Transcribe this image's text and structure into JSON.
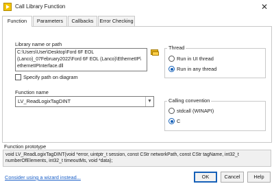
{
  "window": {
    "title": "Call Library Function",
    "close_glyph": "✕"
  },
  "tabs": [
    {
      "label": "Function",
      "active": true
    },
    {
      "label": "Parameters",
      "active": false
    },
    {
      "label": "Callbacks",
      "active": false
    },
    {
      "label": "Error Checking",
      "active": false
    }
  ],
  "library": {
    "label": "Library name or path",
    "path_lines": [
      "C:\\Users\\User\\Desktop\\Ford 6F EOL",
      "(Lanco)_07February2022\\Ford 6F EOL (Lanco)\\EthernetIP\\",
      "ethernetIPInterface.dll"
    ],
    "specify_path_label": "Specify path on diagram",
    "specify_path_checked": false
  },
  "thread": {
    "title": "Thread",
    "options": [
      {
        "label": "Run in UI thread",
        "selected": false
      },
      {
        "label": "Run in any thread",
        "selected": true
      }
    ]
  },
  "function": {
    "label": "Function name",
    "value": "LV_ReadLogixTagDINT"
  },
  "calling_convention": {
    "title": "Calling convention",
    "options": [
      {
        "label": "stdcall (WINAPI)",
        "selected": false
      },
      {
        "label": "C",
        "selected": true
      }
    ]
  },
  "prototype": {
    "label": "Function prototype",
    "lines": [
      "void  LV_ReadLogixTagDINT(void *error, uintptr_t session, const CStr networkPath, const CStr tagName, int32_t",
      "numberOfElements, int32_t timeoutMs, void *data);"
    ]
  },
  "footer": {
    "wizard_link": "Consider using a wizard instead...",
    "ok": "OK",
    "cancel": "Cancel",
    "help": "Help"
  },
  "colors": {
    "accent": "#1560b8",
    "link": "#1a5fc8",
    "app_icon": "#f4c400"
  }
}
